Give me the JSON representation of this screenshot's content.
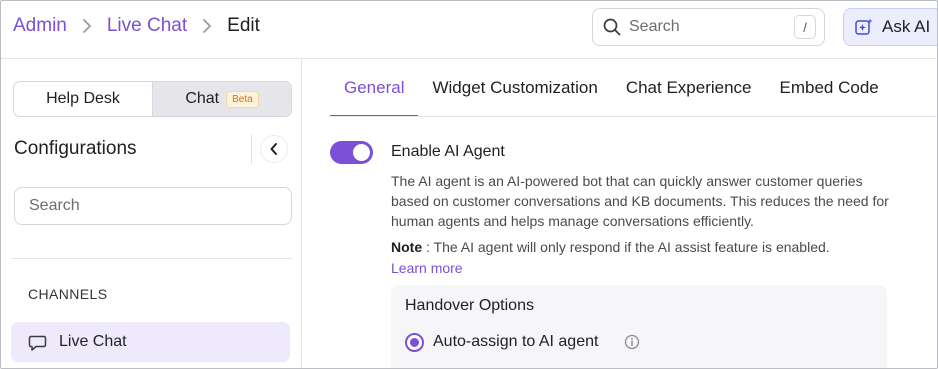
{
  "breadcrumb": {
    "admin": "Admin",
    "live_chat": "Live Chat",
    "current": "Edit"
  },
  "header": {
    "search_placeholder": "Search",
    "search_shortcut": "/",
    "ask_ai_label": "Ask AI"
  },
  "sidebar": {
    "segments": {
      "help_desk": "Help Desk",
      "chat": "Chat",
      "beta_badge": "Beta"
    },
    "title": "Configurations",
    "search_placeholder": "Search",
    "channels_label": "CHANNELS",
    "items": [
      {
        "label": "Live Chat",
        "icon": "chat-bubble-icon"
      }
    ]
  },
  "main": {
    "tabs": [
      {
        "label": "General",
        "active": true
      },
      {
        "label": "Widget Customization",
        "active": false
      },
      {
        "label": "Chat Experience",
        "active": false
      },
      {
        "label": "Embed Code",
        "active": false
      }
    ],
    "ai_agent": {
      "enabled": true,
      "title": "Enable AI Agent",
      "description": "The AI agent is an AI-powered bot that can quickly answer customer queries based on customer conversations and KB documents. This reduces the need for human agents and helps manage conversations efficiently.",
      "note_label": "Note",
      "note_text": " : The AI agent will only respond if the AI assist feature is enabled.",
      "learn_more": "Learn more"
    },
    "handover": {
      "title": "Handover Options",
      "selected_option": "Auto-assign to AI agent"
    }
  },
  "colors": {
    "accent": "#7b4fd6",
    "active_nav_bg": "#efe9fc",
    "ask_ai_bg": "#eceefe"
  }
}
